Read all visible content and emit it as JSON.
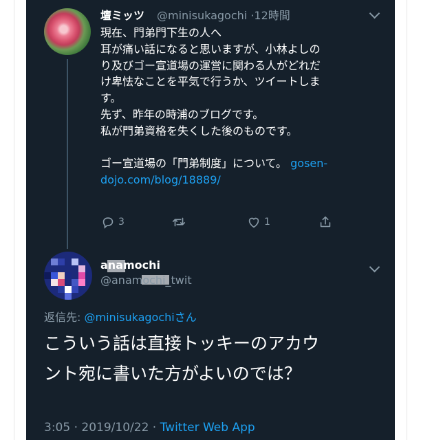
{
  "colors": {
    "background": "#15202b",
    "text": "#ffffff",
    "muted": "#8899a6",
    "link": "#1da1f2"
  },
  "tweet1": {
    "name": "壇ミッツ",
    "handle": "@minisukagochi",
    "separator": "·",
    "time": "12時間",
    "lines": [
      "現在、門弟門下生の人へ",
      "耳が痛い話になると思いますが、小林よしの",
      "り及びゴー宣道場の運営に関わる人がどれだ",
      "け卑怯なことを平気で行うか、ツイートしま",
      "す。",
      "先ず、昨年の時浦のブログです。",
      "私が門弟資格を失くした後のものです。",
      ""
    ],
    "link_line1_prefix": "ゴー宣道場の「門弟制度」について。 ",
    "link_line1_link": "gosen-",
    "link_line2_link": "dojo.com/blog/18889/",
    "actions": {
      "reply_count": "3",
      "retweet_count": "",
      "like_count": "1"
    }
  },
  "tweet2": {
    "name": "anamochi",
    "handle": "@anamochi_twit",
    "reply_prefix": "返信先: ",
    "reply_mention": "@minisukagochiさん",
    "lines": [
      "こういう話は直接トッキーのアカウ",
      "ント宛に書いた方がよいのでは？"
    ],
    "time": "3:05",
    "separator": "·",
    "date": "2019/10/22",
    "separator2": "·",
    "app": "Twitter Web App"
  },
  "icons": [
    "chevron-down-icon",
    "reply-icon",
    "retweet-icon",
    "like-icon",
    "share-icon"
  ]
}
